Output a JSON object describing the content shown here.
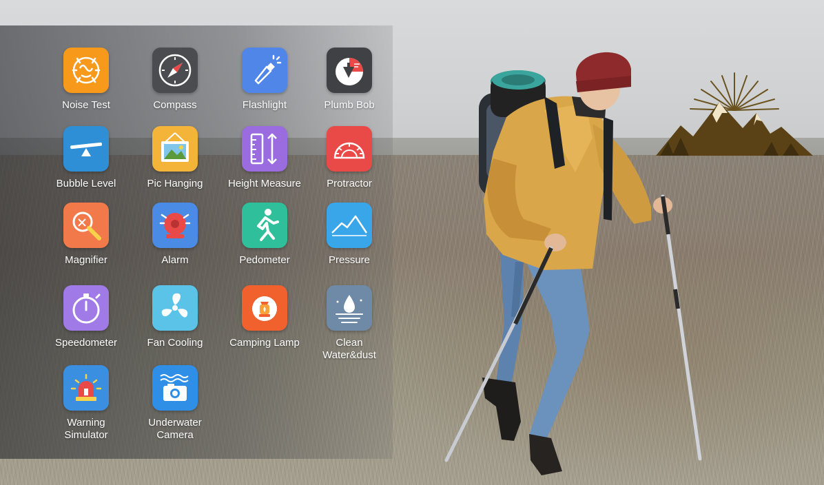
{
  "apps": [
    {
      "label": "Noise Test",
      "icon": "noise-test-icon",
      "color": "#f79a1c"
    },
    {
      "label": "Compass",
      "icon": "compass-icon",
      "color": "#4a4c50"
    },
    {
      "label": "Flashlight",
      "icon": "flashlight-icon",
      "color": "#4f86e8"
    },
    {
      "label": "Plumb Bob",
      "icon": "plumb-bob-icon",
      "color": "#3f4145"
    },
    {
      "label": "Bubble Level",
      "icon": "bubble-level-icon",
      "color": "#2f8fd6"
    },
    {
      "label": "Pic Hanging",
      "icon": "pic-hanging-icon",
      "color": "#f4b43a"
    },
    {
      "label": "Height Measure",
      "icon": "height-measure-icon",
      "color": "#9b6be0"
    },
    {
      "label": "Protractor",
      "icon": "protractor-icon",
      "color": "#e94a48"
    },
    {
      "label": "Magnifier",
      "icon": "magnifier-icon",
      "color": "#f27a4a"
    },
    {
      "label": "Alarm",
      "icon": "alarm-icon",
      "color": "#4a8be6"
    },
    {
      "label": "Pedometer",
      "icon": "pedometer-icon",
      "color": "#2fbf9a"
    },
    {
      "label": "Pressure",
      "icon": "pressure-icon",
      "color": "#3aa6ea"
    },
    {
      "label": "Speedometer",
      "icon": "speedometer-icon",
      "color": "#a07ae6"
    },
    {
      "label": "Fan Cooling",
      "icon": "fan-cooling-icon",
      "color": "#5cc3e8"
    },
    {
      "label": "Camping Lamp",
      "icon": "camping-lamp-icon",
      "color": "#f0612e"
    },
    {
      "label": "Clean\nWater&dust",
      "icon": "clean-water-dust-icon",
      "color": "#6e8aa6"
    },
    {
      "label": "Warning\nSimulator",
      "icon": "warning-simulator-icon",
      "color": "#3a8fe0"
    },
    {
      "label": "Underwater\nCamera",
      "icon": "underwater-camera-icon",
      "color": "#2f8ee6"
    }
  ]
}
